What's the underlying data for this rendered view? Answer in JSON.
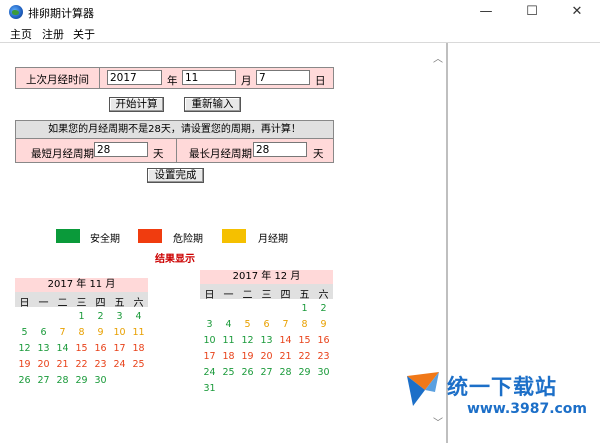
{
  "window": {
    "title": "排卵期计算器",
    "minimize": "—",
    "maximize": "☐",
    "close": "✕"
  },
  "menu": [
    "主页",
    "注册",
    "关于"
  ],
  "form": {
    "last_period_label": "上次月经时间",
    "year_value": "2017",
    "year_unit": "年",
    "month_value": "11",
    "month_unit": "月",
    "day_value": "7",
    "day_unit": "日",
    "start_button": "开始计算",
    "reset_button": "重新输入",
    "notice": "如果您的月经周期不是28天，请设置您的周期，再计算！",
    "min_cycle_label": "最短月经周期",
    "min_cycle_value": "28",
    "min_cycle_unit": "天",
    "max_cycle_label": "最长月经周期",
    "max_cycle_value": "28",
    "max_cycle_unit": "天",
    "settings_button": "设置完成"
  },
  "legend": {
    "safe": {
      "label": "安全期",
      "color": "#0a9a3a"
    },
    "danger": {
      "label": "危险期",
      "color": "#f03c0f"
    },
    "period": {
      "label": "月经期",
      "color": "#f5c000"
    }
  },
  "result_title": "结果显示",
  "weekdays": [
    "日",
    "一",
    "二",
    "三",
    "四",
    "五",
    "六"
  ],
  "calendars": [
    {
      "title": "2017 年 11 月",
      "rows": [
        [
          [
            "",
            ""
          ],
          [
            "",
            ""
          ],
          [
            "",
            ""
          ],
          [
            "1",
            "safe"
          ],
          [
            "2",
            "safe"
          ],
          [
            "3",
            "safe"
          ],
          [
            "4",
            "safe"
          ]
        ],
        [
          [
            "5",
            "safe"
          ],
          [
            "6",
            "safe"
          ],
          [
            "7",
            "period"
          ],
          [
            "8",
            "period"
          ],
          [
            "9",
            "period"
          ],
          [
            "10",
            "period"
          ],
          [
            "11",
            "period"
          ]
        ],
        [
          [
            "12",
            "safe"
          ],
          [
            "13",
            "safe"
          ],
          [
            "14",
            "safe"
          ],
          [
            "15",
            "danger"
          ],
          [
            "16",
            "danger"
          ],
          [
            "17",
            "danger"
          ],
          [
            "18",
            "danger"
          ]
        ],
        [
          [
            "19",
            "danger"
          ],
          [
            "20",
            "danger"
          ],
          [
            "21",
            "danger"
          ],
          [
            "22",
            "danger"
          ],
          [
            "23",
            "danger"
          ],
          [
            "24",
            "danger"
          ],
          [
            "25",
            "danger"
          ]
        ],
        [
          [
            "26",
            "safe"
          ],
          [
            "27",
            "safe"
          ],
          [
            "28",
            "safe"
          ],
          [
            "29",
            "safe"
          ],
          [
            "30",
            "safe"
          ],
          [
            "",
            ""
          ],
          [
            "",
            ""
          ]
        ]
      ]
    },
    {
      "title": "2017 年 12 月",
      "rows": [
        [
          [
            "",
            ""
          ],
          [
            "",
            ""
          ],
          [
            "",
            ""
          ],
          [
            "",
            ""
          ],
          [
            "",
            ""
          ],
          [
            "1",
            "safe"
          ],
          [
            "2",
            "safe"
          ]
        ],
        [
          [
            "3",
            "safe"
          ],
          [
            "4",
            "safe"
          ],
          [
            "5",
            "period"
          ],
          [
            "6",
            "period"
          ],
          [
            "7",
            "period"
          ],
          [
            "8",
            "period"
          ],
          [
            "9",
            "period"
          ]
        ],
        [
          [
            "10",
            "safe"
          ],
          [
            "11",
            "safe"
          ],
          [
            "12",
            "safe"
          ],
          [
            "13",
            "safe"
          ],
          [
            "14",
            "danger"
          ],
          [
            "15",
            "danger"
          ],
          [
            "16",
            "danger"
          ]
        ],
        [
          [
            "17",
            "danger"
          ],
          [
            "18",
            "danger"
          ],
          [
            "19",
            "danger"
          ],
          [
            "20",
            "danger"
          ],
          [
            "21",
            "danger"
          ],
          [
            "22",
            "danger"
          ],
          [
            "23",
            "danger"
          ]
        ],
        [
          [
            "24",
            "safe"
          ],
          [
            "25",
            "safe"
          ],
          [
            "26",
            "safe"
          ],
          [
            "27",
            "safe"
          ],
          [
            "28",
            "safe"
          ],
          [
            "29",
            "safe"
          ],
          [
            "30",
            "safe"
          ]
        ],
        [
          [
            "31",
            "safe"
          ],
          [
            "",
            ""
          ],
          [
            "",
            ""
          ],
          [
            "",
            ""
          ],
          [
            "",
            ""
          ],
          [
            "",
            ""
          ],
          [
            "",
            ""
          ]
        ]
      ]
    }
  ],
  "watermark": {
    "brand": "统一下载站",
    "url": "www.3987.com"
  }
}
